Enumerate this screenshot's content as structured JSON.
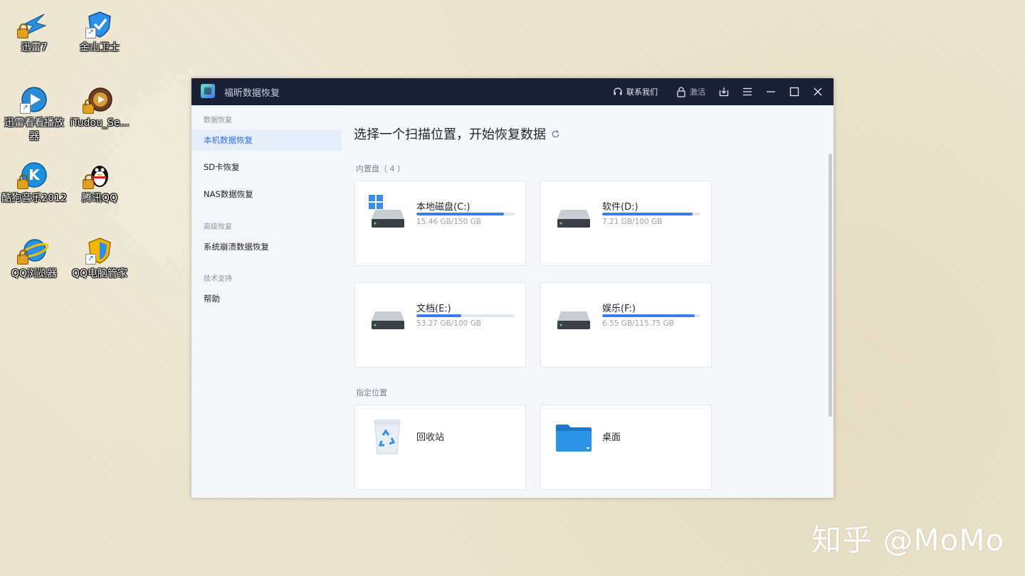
{
  "desktop": {
    "icons": [
      {
        "label": "迅雷7",
        "icon": "thunder-icon"
      },
      {
        "label": "金山卫士",
        "icon": "kingsoft-guard-icon"
      },
      {
        "label": "迅雷看看播放器",
        "icon": "xunlei-player-icon"
      },
      {
        "label": "iTudou_Se...",
        "icon": "itudou-icon"
      },
      {
        "label": "酷狗音乐2012",
        "icon": "kugou-icon"
      },
      {
        "label": "腾讯QQ",
        "icon": "qq-penguin-icon"
      },
      {
        "label": "QQ浏览器",
        "icon": "qq-browser-icon"
      },
      {
        "label": "QQ电脑管家",
        "icon": "qq-pc-manager-icon"
      }
    ]
  },
  "window": {
    "title": "福昕数据恢复",
    "toolbar": {
      "contact_label": "联系我们",
      "activate_label": "激活"
    }
  },
  "sidebar": {
    "sections": [
      {
        "title": "数据恢复",
        "items": [
          {
            "label": "本机数据恢复",
            "active": true
          },
          {
            "label": "SD卡恢复",
            "active": false
          },
          {
            "label": "NAS数据恢复",
            "active": false
          }
        ]
      },
      {
        "title": "高级恢复",
        "items": [
          {
            "label": "系统崩溃数据恢复",
            "active": false
          }
        ]
      },
      {
        "title": "技术支持",
        "items": [
          {
            "label": "帮助",
            "active": false
          }
        ]
      }
    ]
  },
  "main": {
    "heading": "选择一个扫描位置，开始恢复数据",
    "internal_label": "内置盘（ 4 ）",
    "drives": [
      {
        "name": "本地磁盘(C:)",
        "size": "15.46 GB/150 GB",
        "fill": 0.89,
        "system": true
      },
      {
        "name": "软件(D:)",
        "size": "7.21 GB/100 GB",
        "fill": 0.92,
        "system": false
      },
      {
        "name": "文档(E:)",
        "size": "53.27 GB/100 GB",
        "fill": 0.46,
        "system": false
      },
      {
        "name": "娱乐(F:)",
        "size": "6.55 GB/115.75 GB",
        "fill": 0.94,
        "system": false
      }
    ],
    "locations_label": "指定位置",
    "locations": [
      {
        "name": "回收站",
        "icon": "recycle-bin-icon"
      },
      {
        "name": "桌面",
        "icon": "desktop-folder-icon"
      }
    ]
  },
  "watermark": "知乎 @MoMo",
  "colors": {
    "titlebar": "#1a2036",
    "accent": "#2f6fe8",
    "progress": "#3d7ee6"
  }
}
